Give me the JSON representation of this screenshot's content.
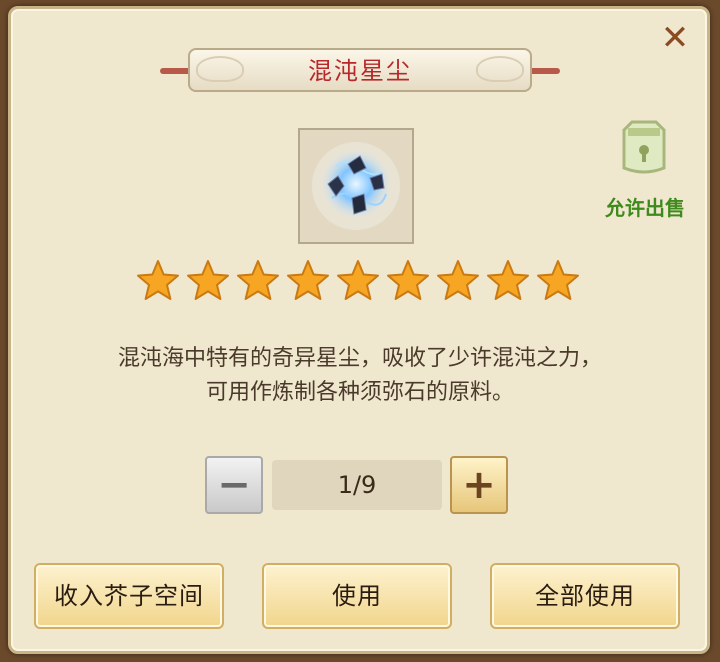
{
  "dialog": {
    "title": "混沌星尘",
    "close_icon": "close-icon",
    "sell_badge": {
      "icon": "lock-bag-icon",
      "label": "允许出售"
    },
    "item": {
      "icon": "star-dust-crystal-icon"
    },
    "stars": {
      "count": 9,
      "color": "#f6a623"
    },
    "description": [
      "混沌海中特有的奇异星尘，吸收了少许混沌之力，",
      "可用作炼制各种须弥石的原料。"
    ],
    "quantity": {
      "value": "1/9",
      "minus_icon": "minus-icon",
      "plus_icon": "plus-icon"
    },
    "buttons": {
      "store": "收入芥子空间",
      "use": "使用",
      "use_all": "全部使用"
    }
  }
}
